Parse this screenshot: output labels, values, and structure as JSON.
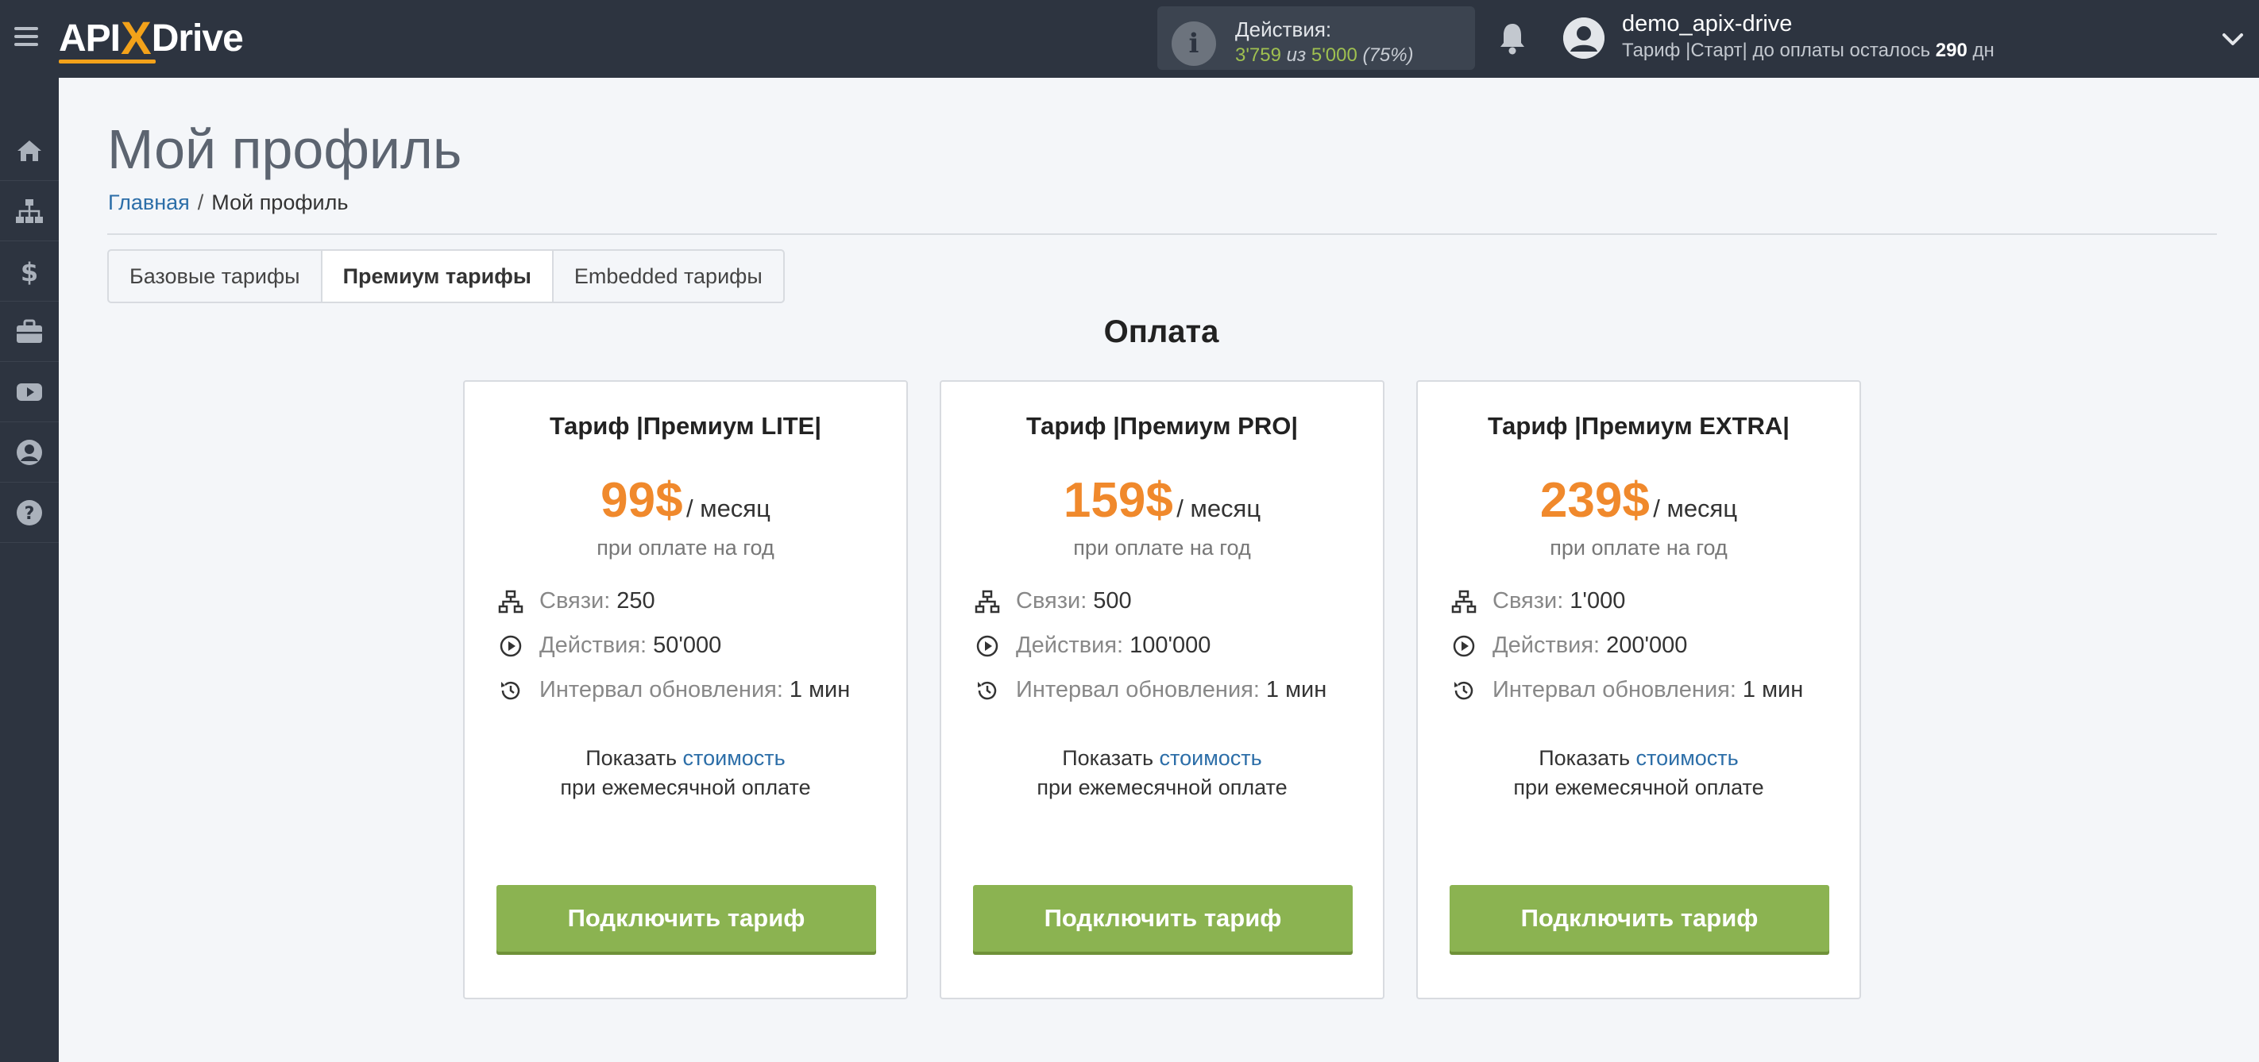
{
  "header": {
    "logo": {
      "left": "API",
      "x": "X",
      "right": "Drive"
    },
    "actions": {
      "title": "Действия:",
      "used": "3'759",
      "of": "из",
      "total": "5'000",
      "percent": "(75%)"
    },
    "user": {
      "name": "demo_apix-drive",
      "plan_prefix": "Тариф |Старт| до оплаты осталось",
      "days": "290",
      "days_suffix": "дн"
    }
  },
  "sidebar": {
    "items": [
      "home-icon",
      "sitemap-icon",
      "dollar-icon",
      "briefcase-icon",
      "youtube-icon",
      "user-circle-icon",
      "help-icon"
    ]
  },
  "page": {
    "title": "Мой профиль",
    "breadcrumb": {
      "home": "Главная",
      "sep": "/",
      "current": "Мой профиль"
    }
  },
  "tabs": [
    {
      "label": "Базовые тарифы",
      "active": false
    },
    {
      "label": "Премиум тарифы",
      "active": true
    },
    {
      "label": "Embedded тарифы",
      "active": false
    }
  ],
  "section_title": "Оплата",
  "plans": [
    {
      "title": "Тариф |Премиум LITE|",
      "price": "99$",
      "per": "/ месяц",
      "yearly": "при оплате на год",
      "links_label": "Связи:",
      "links_value": "250",
      "actions_label": "Действия:",
      "actions_value": "50'000",
      "interval_label": "Интервал обновления:",
      "interval_value": "1 мин",
      "monthly_prefix": "Показать",
      "monthly_link": "стоимость",
      "monthly_suffix": "при ежемесячной оплате",
      "button": "Подключить тариф"
    },
    {
      "title": "Тариф |Премиум PRO|",
      "price": "159$",
      "per": "/ месяц",
      "yearly": "при оплате на год",
      "links_label": "Связи:",
      "links_value": "500",
      "actions_label": "Действия:",
      "actions_value": "100'000",
      "interval_label": "Интервал обновления:",
      "interval_value": "1 мин",
      "monthly_prefix": "Показать",
      "monthly_link": "стоимость",
      "monthly_suffix": "при ежемесячной оплате",
      "button": "Подключить тариф"
    },
    {
      "title": "Тариф |Премиум EXTRA|",
      "price": "239$",
      "per": "/ месяц",
      "yearly": "при оплате на год",
      "links_label": "Связи:",
      "links_value": "1'000",
      "actions_label": "Действия:",
      "actions_value": "200'000",
      "interval_label": "Интервал обновления:",
      "interval_value": "1 мин",
      "monthly_prefix": "Показать",
      "monthly_link": "стоимость",
      "monthly_suffix": "при ежемесячной оплате",
      "button": "Подключить тариф"
    }
  ],
  "colors": {
    "topbar": "#2d3440",
    "accent_orange": "#f0892c",
    "button_green": "#8bb351",
    "link_blue": "#2c6ea8",
    "actions_green": "#9fc050"
  }
}
